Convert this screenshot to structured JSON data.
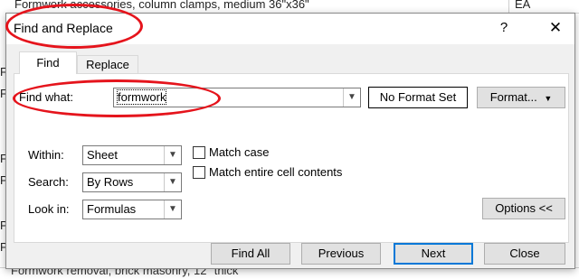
{
  "background_sheet": {
    "top_row_text": "Formwork accessories, column clamps, medium 36\"x36\"",
    "top_row_unit": "EA",
    "left_column_letters": [
      "F",
      "F",
      "F",
      "P",
      "P",
      "P"
    ],
    "bottom_row_text": "Formwork removal, brick masonry, 12\" thick"
  },
  "dialog": {
    "title": "Find and Replace",
    "help_glyph": "?",
    "close_glyph": "✕",
    "tabs": [
      {
        "label": "Find",
        "active": true
      },
      {
        "label": "Replace",
        "active": false
      }
    ],
    "find_what_label": "Find what:",
    "find_what_value": "formwork",
    "format_preview": "No Format Set",
    "format_button": "Format...",
    "within_label": "Within:",
    "within_value": "Sheet",
    "search_label": "Search:",
    "search_value": "By Rows",
    "look_in_label": "Look in:",
    "look_in_value": "Formulas",
    "match_case_label": "Match case",
    "match_case_checked": false,
    "match_entire_label": "Match entire cell contents",
    "match_entire_checked": false,
    "options_button": "Options <<",
    "buttons": {
      "find_all": "Find All",
      "previous": "Previous",
      "next": "Next",
      "close": "Close"
    }
  },
  "annotations": {
    "highlight_color": "#e5141c"
  },
  "colors": {
    "dialog_bg": "#f0f0f0",
    "primary_border": "#0078d7"
  },
  "icons": {
    "dropdown_arrow": "chevron-down-icon",
    "format_arrow": "caret-down-icon"
  }
}
